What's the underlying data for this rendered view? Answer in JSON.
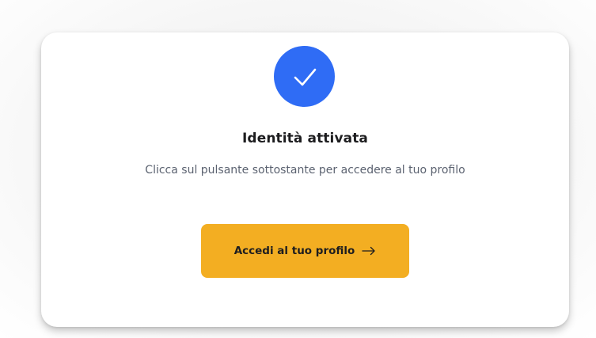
{
  "card": {
    "title": "Identità attivata",
    "subtitle": "Clicca sul pulsante sottostante per accedere al tuo profilo",
    "button_label": "Accedi al tuo profilo",
    "status_icon": "check-icon",
    "button_icon": "arrow-right-icon"
  },
  "colors": {
    "accent_blue": "#2f6cf5",
    "button_yellow": "#f3ae22",
    "title_text": "#1d1d1f",
    "subtitle_text": "#5b6270"
  }
}
